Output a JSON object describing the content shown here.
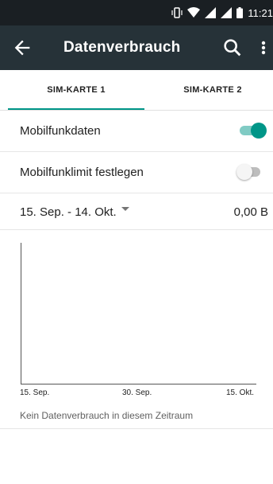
{
  "status_bar": {
    "time": "11:21",
    "icons": [
      "vibrate-icon",
      "wifi-icon",
      "signal-icon",
      "signal-roaming-icon",
      "battery-icon"
    ]
  },
  "app_bar": {
    "title": "Datenverbrauch",
    "background": "#263238",
    "icons": [
      "back-arrow-icon",
      "search-icon",
      "more-vert-icon"
    ]
  },
  "tabs": [
    {
      "label": "SIM-KARTE 1",
      "selected": true
    },
    {
      "label": "SIM-KARTE 2",
      "selected": false
    }
  ],
  "accent_color": "#009688",
  "settings": {
    "mobile_data": {
      "label": "Mobilfunkdaten",
      "enabled": true
    },
    "mobile_limit": {
      "label": "Mobilfunklimit festlegen",
      "enabled": false
    }
  },
  "cycle": {
    "range": "15. Sep. - 14. Okt.",
    "usage": "0,00 B"
  },
  "chart": {
    "x_labels": [
      "15. Sep.",
      "30. Sep.",
      "15. Okt."
    ],
    "empty_message": "Kein Datenverbrauch in diesem Zeitraum"
  }
}
